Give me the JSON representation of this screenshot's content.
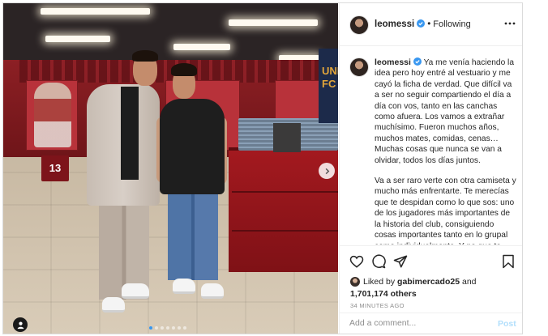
{
  "post": {
    "username": "leomessi",
    "follow_status": "Following",
    "caption_paragraphs": [
      "Ya me venía haciendo la idea pero hoy entré al vestuario y me cayó la ficha de verdad. Que difícil va a ser no seguir compartiendo el día a día con vos, tanto en las canchas como afuera. Los vamos a extrañar muchísimo. Fueron muchos años, muchos mates, comidas, cenas… Muchas cosas que nunca se van a olvidar, todos los días juntos.",
      "Va a ser raro verte con otra camiseta y mucho más enfrentarte. Te merecías que te despidan como lo que sos: uno de los jugadores más importantes de la historia del club, consiguiendo cosas importantes tanto en lo grupal como individualmente. Y no que te echen como lo hicieron. Pero la verdad que a"
    ],
    "liked_by_prefix": "Liked by",
    "liked_by_user": "gabimercado25",
    "liked_by_and": "and",
    "likes_count": "1,701,174 others",
    "timestamp": "34 MINUTES AGO"
  },
  "photo": {
    "locker_number": "13",
    "banner_text": "UNI FC",
    "carousel_total": 7,
    "carousel_active": 0
  },
  "comment": {
    "placeholder": "Add a comment...",
    "post_label": "Post"
  },
  "icons": {
    "verified": "verified-badge-icon",
    "more": "more-horizontal-icon",
    "like": "heart-icon",
    "comment": "comment-bubble-icon",
    "share": "paper-plane-icon",
    "save": "bookmark-icon",
    "tag": "user-tag-icon",
    "next": "chevron-right-icon"
  },
  "colors": {
    "verified_blue": "#3897f0",
    "post_disabled": "#b2dffc",
    "muted_text": "#8e8e8e",
    "border": "#dbdbdb"
  }
}
